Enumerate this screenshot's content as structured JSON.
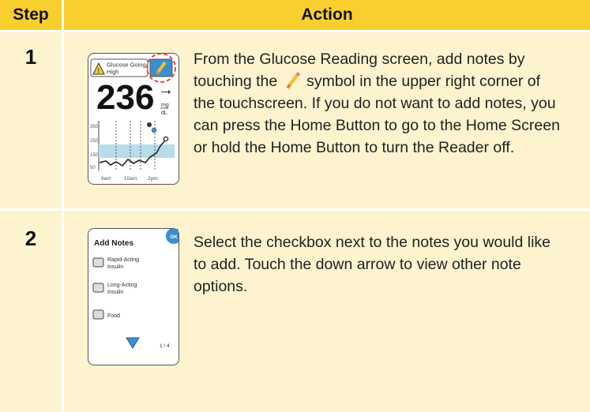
{
  "table": {
    "header_step": "Step",
    "header_action": "Action",
    "header_color": "#f9cf2e",
    "row_color": "#fdf3cf"
  },
  "rows": [
    {
      "step": "1",
      "text_before_icon": "From the Glucose Reading screen, add notes by touching the",
      "text_after_icon": "symbol in the upper right corner of the touchscreen. If you do not want to add notes, you can press the Home Button to go to the Home Screen or hold the Home Button to turn the Reader off.",
      "icon": "pencil-icon",
      "device": {
        "alert_label": "Glucose Going High",
        "reading": "236",
        "unit_top": "mg",
        "unit_bottom": "dL",
        "y_ticks": [
          "350",
          "250",
          "150",
          "50"
        ],
        "x_ticks": [
          "6am",
          "10am",
          "2pm"
        ]
      }
    },
    {
      "step": "2",
      "text": "Select the checkbox next to the notes you would like to add. Touch the down arrow to view other note options.",
      "device": {
        "title": "Add Notes",
        "ok_label": "OK",
        "options": [
          "Rapid-Acting Insulin",
          "Long-Acting Insulin",
          "Food"
        ],
        "page": "1 / 4"
      }
    }
  ]
}
